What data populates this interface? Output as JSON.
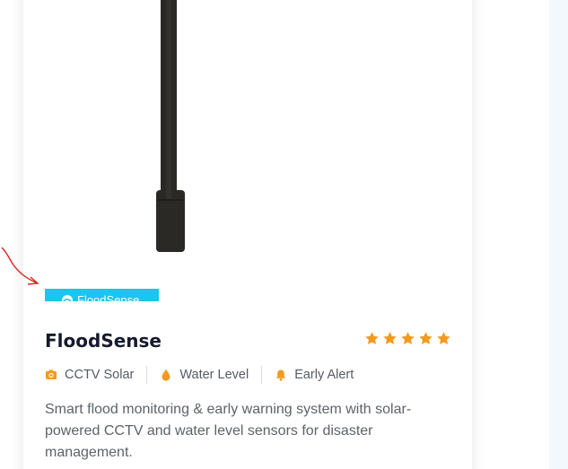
{
  "product": {
    "badge_text": "FloodSense",
    "title": "FloodSense",
    "rating": 5,
    "rating_max": 5,
    "features": [
      {
        "label": "CCTV Solar",
        "icon": "camera-icon"
      },
      {
        "label": "Water Level",
        "icon": "water-drop-icon"
      },
      {
        "label": "Early Alert",
        "icon": "bell-icon"
      }
    ],
    "description": "Smart flood monitoring & early warning system with solar-powered CCTV and water level sensors for disaster management."
  },
  "colors": {
    "accent_orange": "#f39a1e",
    "badge_blue": "#1cc5ec",
    "title_dark": "#151a2d",
    "annotation_red": "#e02020"
  }
}
